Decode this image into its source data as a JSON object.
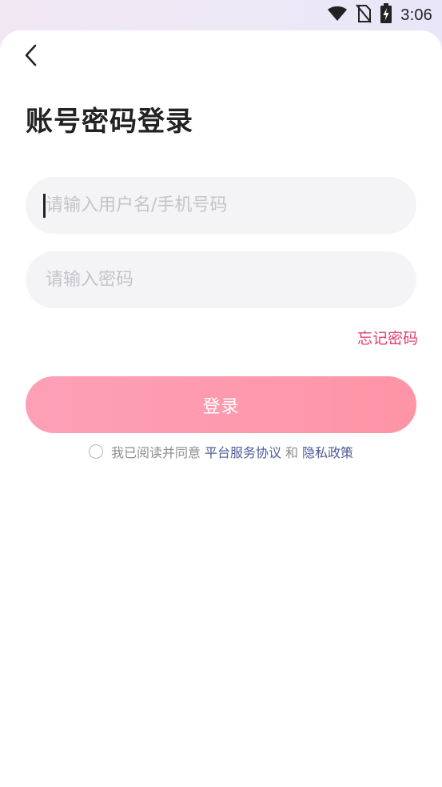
{
  "status_bar": {
    "time": "3:06",
    "icons": [
      "wifi-icon",
      "no-sim-icon",
      "battery-charging-icon"
    ]
  },
  "header": {
    "back_icon": "chevron-left-icon",
    "title": "账号密码登录"
  },
  "form": {
    "username_placeholder": "请输入用户名/手机号码",
    "username_value": "",
    "password_placeholder": "请输入密码",
    "password_value": "",
    "forgot_label": "忘记密码",
    "login_label": "登录"
  },
  "agreement": {
    "checked": false,
    "prefix": "我已阅读并同意",
    "terms_label": "平台服务协议",
    "conjunction": "和",
    "privacy_label": "隐私政策"
  },
  "colors": {
    "accent": "#e63d6d",
    "button_start": "#fda0b7",
    "button_end": "#fe94a6",
    "link": "#505b9a",
    "field_bg": "#f4f4f6"
  }
}
